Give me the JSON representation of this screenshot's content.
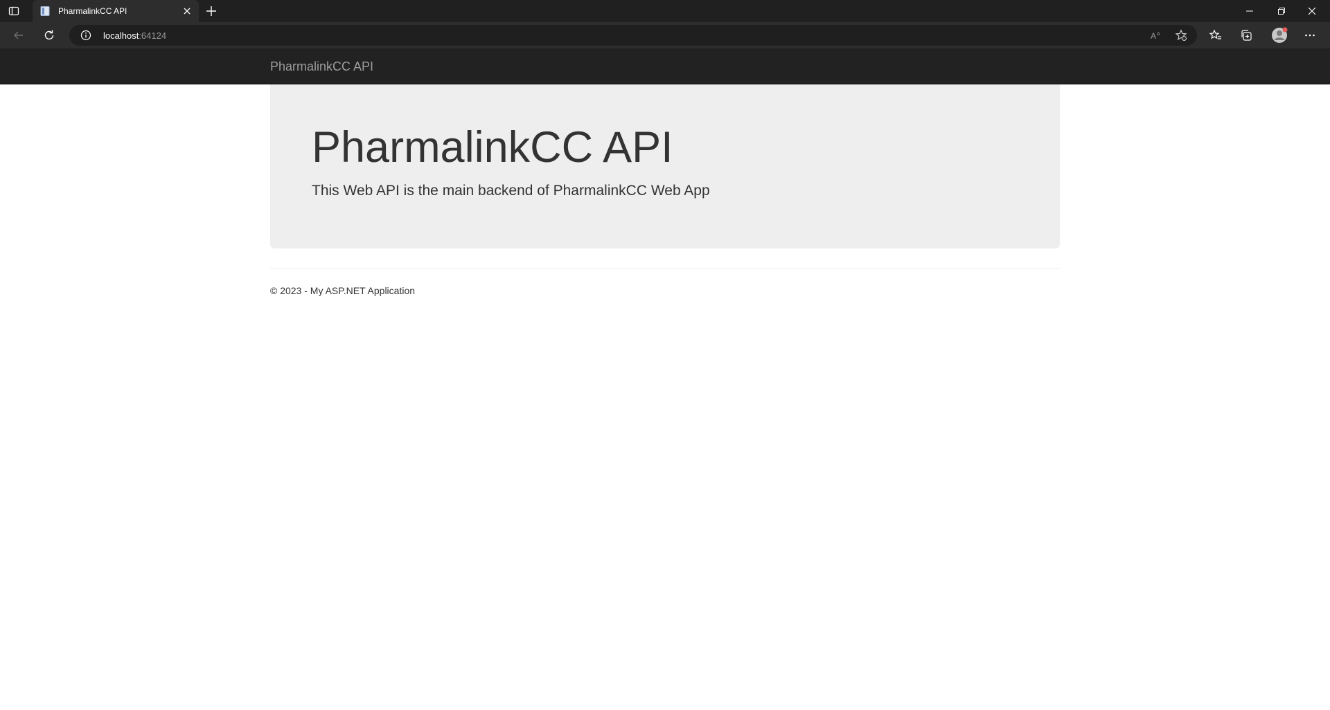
{
  "browser": {
    "tab": {
      "title": "PharmalinkCC API"
    },
    "address": {
      "host": "localhost",
      "port": ":64124"
    }
  },
  "page": {
    "navbar": {
      "brand": "PharmalinkCC API"
    },
    "jumbotron": {
      "title": "PharmalinkCC API",
      "lead": "This Web API is the main backend of PharmalinkCC Web App"
    },
    "footer": {
      "text": "© 2023 - My ASP.NET Application"
    }
  },
  "colors": {
    "chrome_dark": "#202020",
    "navbar_bg": "#222222",
    "brand_text": "#9d9d9d",
    "jumbotron_bg": "#eeeeee"
  }
}
